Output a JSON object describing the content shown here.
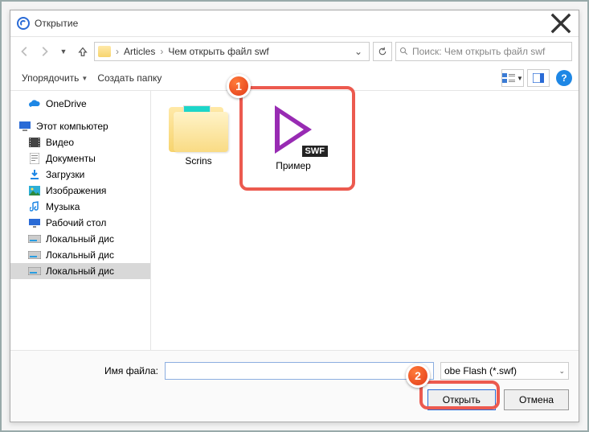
{
  "window": {
    "title": "Открытие"
  },
  "nav": {
    "breadcrumb": {
      "root": "Articles",
      "current": "Чем открыть файл swf"
    },
    "search_placeholder": "Поиск: Чем открыть файл swf"
  },
  "toolbar": {
    "organize": "Упорядочить",
    "new_folder": "Создать папку"
  },
  "sidebar": {
    "items": [
      {
        "label": "OneDrive",
        "icon": "cloud"
      },
      {
        "label": "Этот компьютер",
        "icon": "pc"
      },
      {
        "label": "Видео",
        "icon": "video"
      },
      {
        "label": "Документы",
        "icon": "docs"
      },
      {
        "label": "Загрузки",
        "icon": "downloads"
      },
      {
        "label": "Изображения",
        "icon": "images"
      },
      {
        "label": "Музыка",
        "icon": "music"
      },
      {
        "label": "Рабочий стол",
        "icon": "desktop"
      },
      {
        "label": "Локальный дис",
        "icon": "disk"
      },
      {
        "label": "Локальный дис",
        "icon": "disk"
      },
      {
        "label": "Локальный дис",
        "icon": "disk"
      }
    ]
  },
  "files": {
    "folder": {
      "name": "Scrins"
    },
    "swf": {
      "name": "Пример",
      "badge": "SWF"
    }
  },
  "footer": {
    "filename_label": "Имя файла:",
    "filename_value": "",
    "filetype": "obe Flash (*.swf)",
    "open": "Открыть",
    "cancel": "Отмена"
  },
  "annotations": {
    "badge1": "1",
    "badge2": "2"
  }
}
